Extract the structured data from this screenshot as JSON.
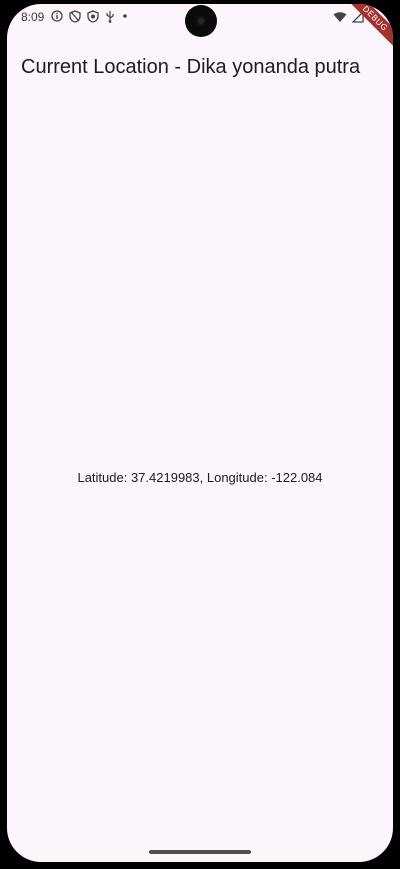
{
  "status_bar": {
    "time": "8:09",
    "left_icons": [
      "info-icon",
      "shield-off-icon",
      "shield-icon",
      "usb-debug-icon",
      "dot-icon"
    ],
    "right_icons": [
      "wifi-icon",
      "signal-icon",
      "battery-icon"
    ],
    "debug_banner": "DEBUG"
  },
  "app_bar": {
    "title": "Current Location - Dika yonanda putra"
  },
  "main": {
    "location_text": "Latitude: 37.4219983, Longitude: -122.084"
  },
  "colors": {
    "background": "#fcf6fc",
    "text": "#1d1b20",
    "debug_banner": "#a3312f"
  }
}
